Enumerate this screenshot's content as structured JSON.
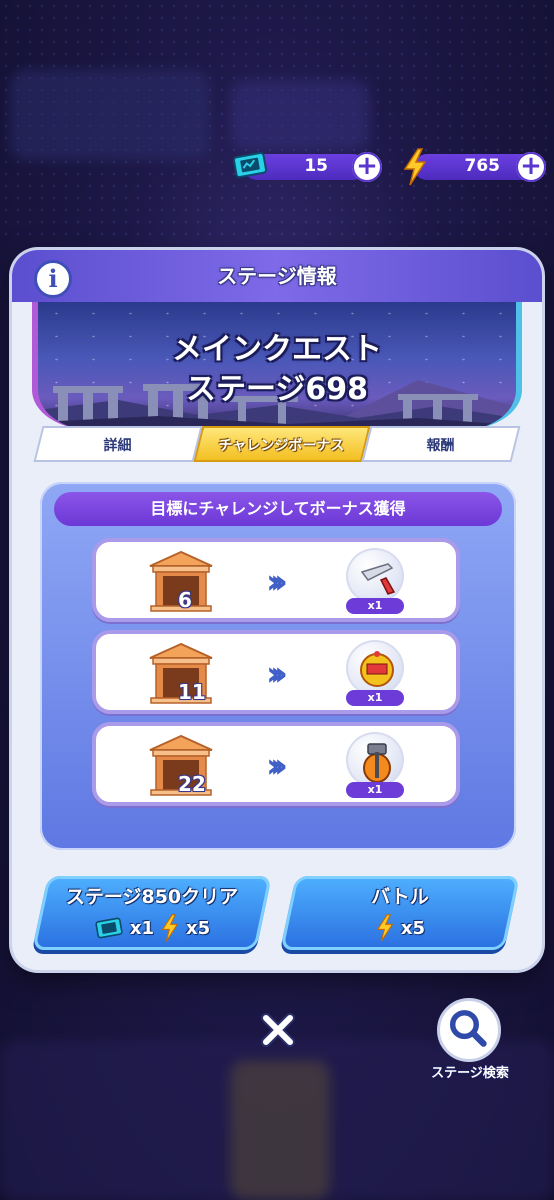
{
  "currency": {
    "tickets": {
      "icon": "ticket-icon",
      "value": "15"
    },
    "energy": {
      "icon": "lightning-icon",
      "value": "765"
    }
  },
  "dialog": {
    "title": "ステージ情報",
    "info_icon": "i",
    "banner": {
      "line1": "メインクエスト",
      "line2": "ステージ698"
    },
    "tabs": [
      {
        "label": "詳細",
        "active": false
      },
      {
        "label": "チャレンジボーナス",
        "active": true
      },
      {
        "label": "報酬",
        "active": false
      }
    ],
    "panel_heading": "目標にチャレンジしてボーナス獲得",
    "rows": [
      {
        "count": "6",
        "reward_icon": "sword-icon",
        "qty": "x1"
      },
      {
        "count": "11",
        "reward_icon": "gold-emblem-icon",
        "qty": "x1"
      },
      {
        "count": "22",
        "reward_icon": "hammer-icon",
        "qty": "x1"
      }
    ],
    "buttons": {
      "clear": {
        "title": "ステージ850クリア",
        "ticket_cost": "x1",
        "energy_cost": "x5"
      },
      "battle": {
        "title": "バトル",
        "energy_cost": "x5"
      }
    }
  },
  "footer": {
    "search_label": "ステージ検索"
  },
  "colors": {
    "accent": "#6c38d6",
    "button": "#2a6fe0",
    "tab_active": "#f3bf22"
  }
}
